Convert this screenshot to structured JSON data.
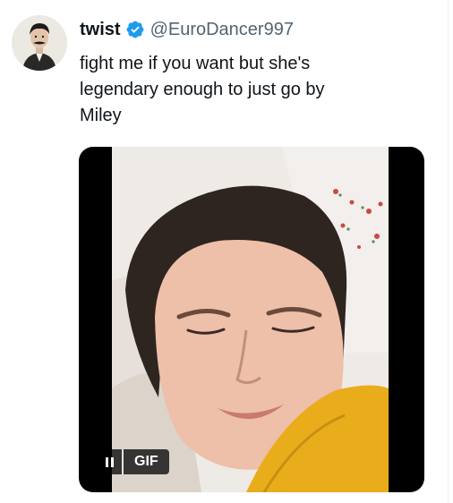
{
  "tweet": {
    "display_name": "twist",
    "handle": "@EuroDancer997",
    "verified": true,
    "text": "fight me if you want but she's\nlegendary enough to just go by\nMiley",
    "avatar_icon": "portrait-avatar",
    "media": {
      "type": "GIF",
      "badge_label": "GIF",
      "playback_state": "playing",
      "pause_icon": "pause-icon"
    }
  },
  "colors": {
    "verified_blue": "#1d9bf0",
    "text_primary": "#0f1419",
    "text_secondary": "#536471",
    "shirt_yellow": "#e9ad1c"
  }
}
